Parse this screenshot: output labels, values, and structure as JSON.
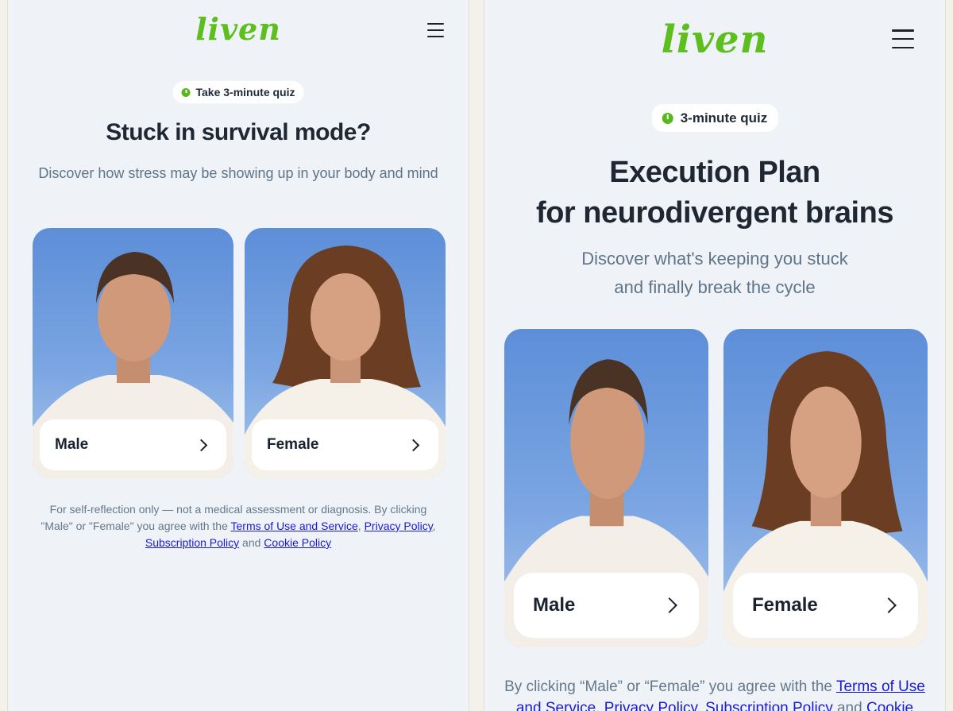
{
  "brand": {
    "logo_text": "liven",
    "logo_color": "#5cbf1d"
  },
  "screens": [
    {
      "quiz_badge": "Take 3-minute quiz",
      "headline": [
        "Stuck in survival mode?"
      ],
      "subtitle": [
        "Discover how stress may be showing up in your body and mind"
      ],
      "options": [
        {
          "label": "Male",
          "icon": "chevron-right-icon"
        },
        {
          "label": "Female",
          "icon": "chevron-right-icon"
        }
      ],
      "legal": {
        "prefix": "For self-reflection only — not a medical assessment or diagnosis. By clicking \"Male\" or \"Female\" you agree with the ",
        "terms": "Terms of Use and Service",
        "sep1": ", ",
        "privacy": "Privacy Policy",
        "sep2": ", ",
        "subscription": "Subscription Policy",
        "sep3": " and ",
        "cookie": "Cookie Policy"
      }
    },
    {
      "quiz_badge": "3-minute quiz",
      "headline": [
        "Execution Plan",
        "for neurodivergent brains"
      ],
      "subtitle": [
        "Discover what's keeping you stuck",
        "and finally break the cycle"
      ],
      "options": [
        {
          "label": "Male",
          "icon": "chevron-right-icon"
        },
        {
          "label": "Female",
          "icon": "chevron-right-icon"
        }
      ],
      "legal": {
        "prefix": "By clicking “Male” or “Female” you agree with the ",
        "terms": "Terms of Use and Service",
        "sep1": ", ",
        "privacy": "Privacy Policy",
        "sep2": ", ",
        "subscription": "Subscription Policy",
        "sep3": " and ",
        "cookie": "Cookie"
      }
    }
  ]
}
